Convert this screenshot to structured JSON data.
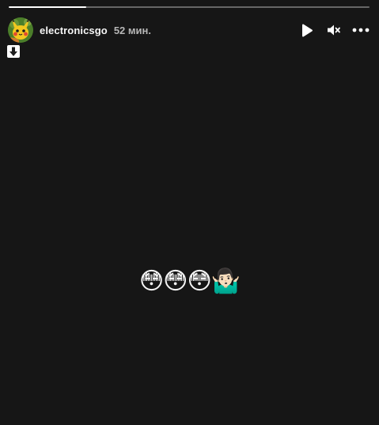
{
  "story": {
    "progress_fraction": 0.215,
    "username": "electronicsgo",
    "time_ago": "52 мин.",
    "sticker_text": "😳😳😳🤷🏻‍♂️",
    "icons": {
      "avatar": "pikachu-avatar",
      "play": "play-icon",
      "mute": "muted-speaker-icon",
      "more": "more-horizontal-icon",
      "sticker": "down-arrow-icon"
    },
    "colors": {
      "background": "#161616",
      "text": "#f5f5f5",
      "muted_text": "#b7b7b7",
      "progress_track": "rgba(255,255,255,0.35)",
      "progress_fill": "#ffffff"
    }
  }
}
